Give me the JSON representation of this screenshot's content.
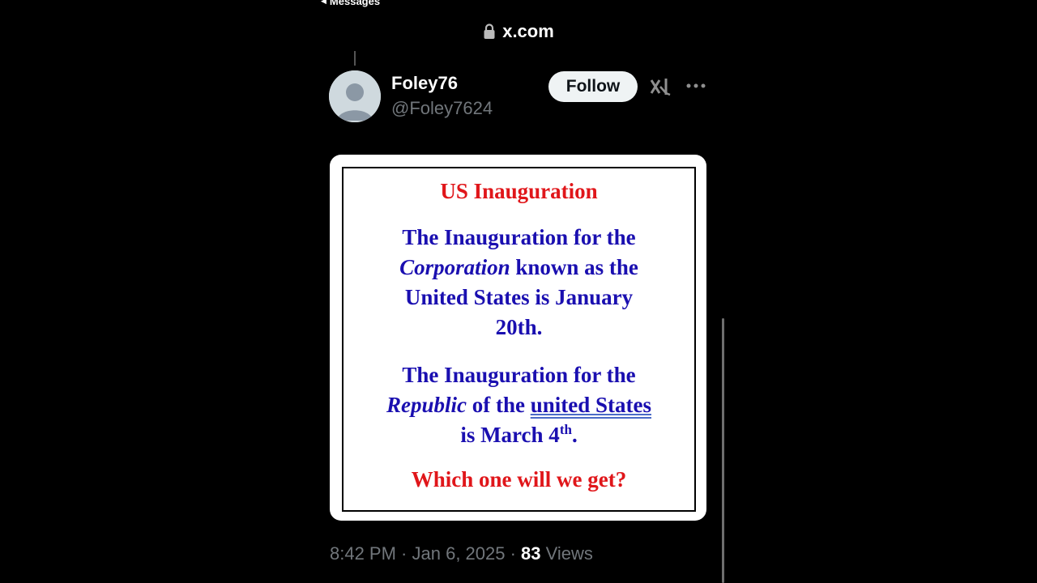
{
  "status_bar": {
    "back_label": "Messages"
  },
  "browser": {
    "url": "x.com"
  },
  "post": {
    "author": {
      "display_name": "Foley76",
      "handle": "@Foley7624"
    },
    "follow_label": "Follow",
    "image": {
      "title": "US Inauguration",
      "para1": {
        "line1": "The Inauguration for the",
        "italic": "Corporation",
        "line2_rest": " known as the",
        "line3": "United States is January",
        "line4": "20th."
      },
      "para2": {
        "line1": "The Inauguration for the",
        "italic": "Republic",
        "mid": " of the ",
        "underlined": "united States",
        "line3_start": "is March 4",
        "sup": "th",
        "line3_end": "."
      },
      "question": "Which one will we get?"
    },
    "meta": {
      "time": "8:42 PM",
      "sep1": " · ",
      "date": "Jan 6, 2025",
      "sep2": " · ",
      "views_count": "83",
      "views_label": " Views"
    }
  },
  "icons": {
    "lock": "lock-icon",
    "grok": "grok-icon",
    "more": "more-icon",
    "avatar": "default-avatar-icon"
  }
}
